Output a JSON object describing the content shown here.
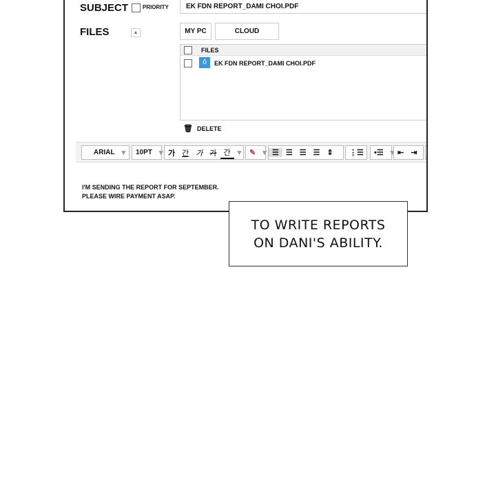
{
  "form": {
    "subject_label": "SUBJECT",
    "priority_label": "PRIORITY",
    "subject_value": "EK FDN REPORT_DAMI CHOI.PDF",
    "files_label": "FILES",
    "my_pc": "MY PC",
    "cloud": "CLOUD",
    "files_header": "FILES",
    "files": [
      {
        "name": "EK FDN REPORT_DAMI CHOI.PDF",
        "icon": "pdf-file-icon"
      }
    ],
    "delete": "DELETE"
  },
  "toolbar": {
    "font": "ARIAL",
    "size": "10PT",
    "styles": [
      "가",
      "간",
      "가",
      "가",
      "간"
    ],
    "align_icons": [
      "align-left",
      "align-center",
      "align-right",
      "justify",
      "line-height"
    ]
  },
  "body": {
    "lines": [
      "I'M SENDING THE REPORT FOR SEPTEMBER.",
      "PLEASE WIRE PAYMENT ASAP."
    ]
  },
  "caption": {
    "lines": [
      "TO WRITE REPORTS",
      "ON DANI'S ABILITY."
    ]
  }
}
